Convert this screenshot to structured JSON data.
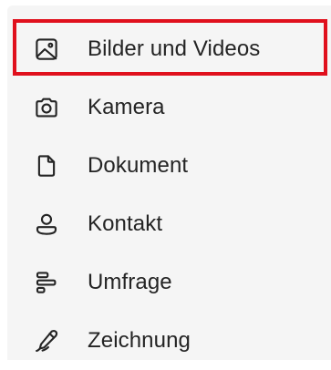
{
  "menu": {
    "items": [
      {
        "label": "Bilder und Videos",
        "icon": "image-icon"
      },
      {
        "label": "Kamera",
        "icon": "camera-icon"
      },
      {
        "label": "Dokument",
        "icon": "document-icon"
      },
      {
        "label": "Kontakt",
        "icon": "contact-icon"
      },
      {
        "label": "Umfrage",
        "icon": "poll-icon"
      },
      {
        "label": "Zeichnung",
        "icon": "pen-icon"
      }
    ]
  },
  "colors": {
    "panel_background": "#f5f5f5",
    "text": "#242424",
    "highlight": "#e0101d"
  }
}
